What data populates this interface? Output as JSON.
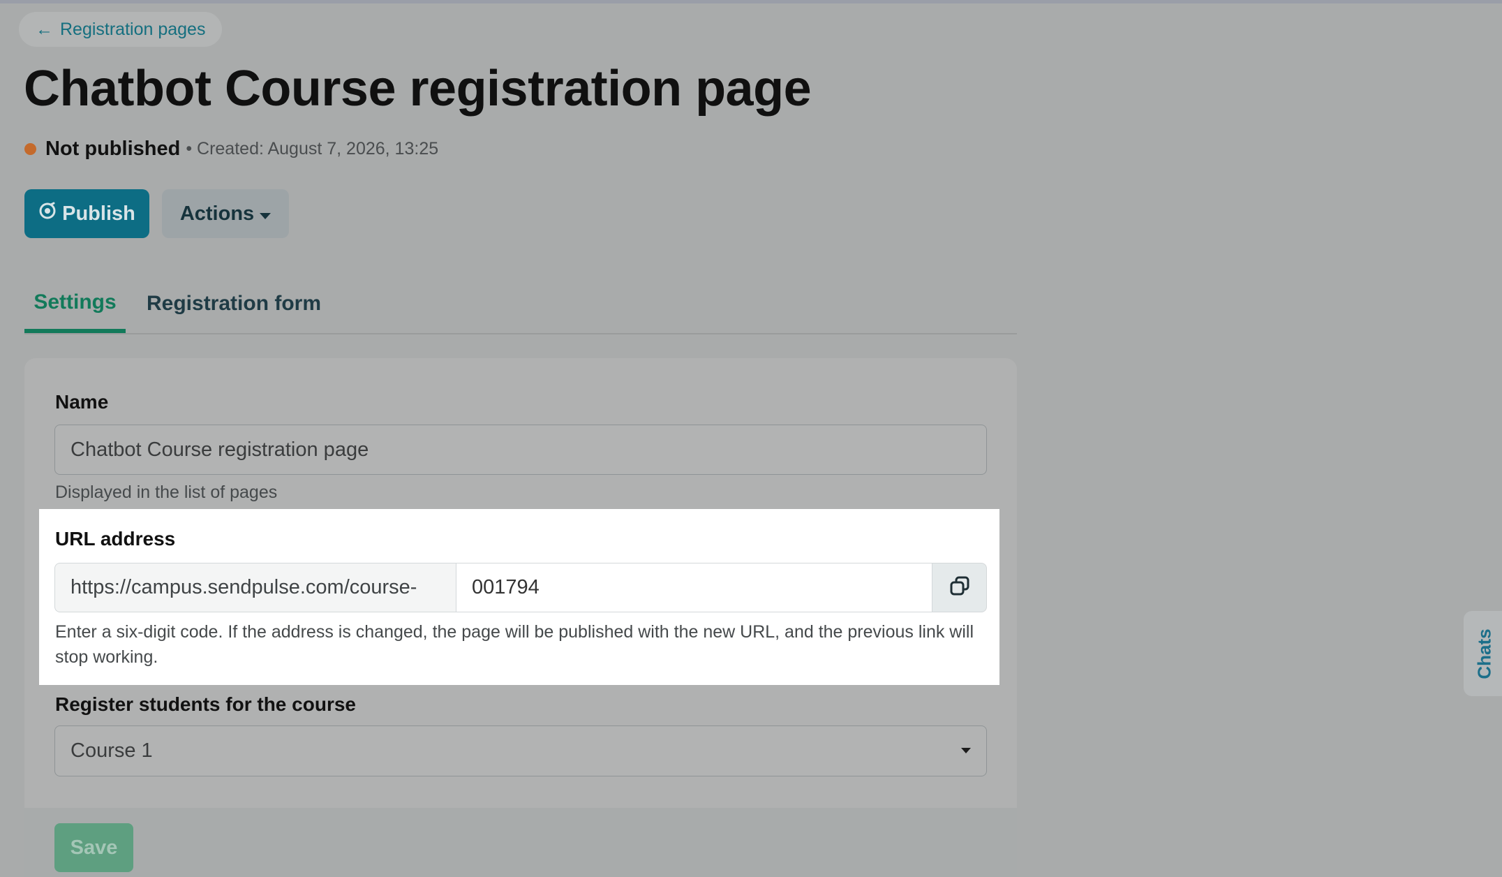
{
  "nav": {
    "back_arrow": "←",
    "back_label": "Registration pages"
  },
  "page": {
    "title": "Chatbot Course registration page",
    "status": "Not published",
    "created": "• Created: August 7, 2026, 13:25",
    "status_color": "#c46a2c"
  },
  "toolbar": {
    "publish_label": "Publish",
    "actions_label": "Actions"
  },
  "tabs": [
    {
      "label": "Settings",
      "active": true
    },
    {
      "label": "Registration form",
      "active": false
    }
  ],
  "form": {
    "name_label": "Name",
    "name_value": "Chatbot Course registration page",
    "name_hint": "Displayed in the list of pages",
    "url_label": "URL address",
    "url_prefix": "https://campus.sendpulse.com/course-",
    "url_code": "001794",
    "url_hint": "Enter a six-digit code. If the address is changed, the page will be published with the new URL, and the previous link will stop working.",
    "course_label": "Register students for the course",
    "course_value": "Course 1",
    "save_label": "Save"
  },
  "side": {
    "chats_label": "Chats"
  },
  "icons": {
    "publish": "broadcast-icon",
    "actions": "caret-down-icon",
    "copy": "copy-icon",
    "select": "caret-down-icon"
  },
  "colors": {
    "accent_teal": "#0d6d84",
    "tab_active": "#127a5a",
    "save": "#5e9f80"
  }
}
